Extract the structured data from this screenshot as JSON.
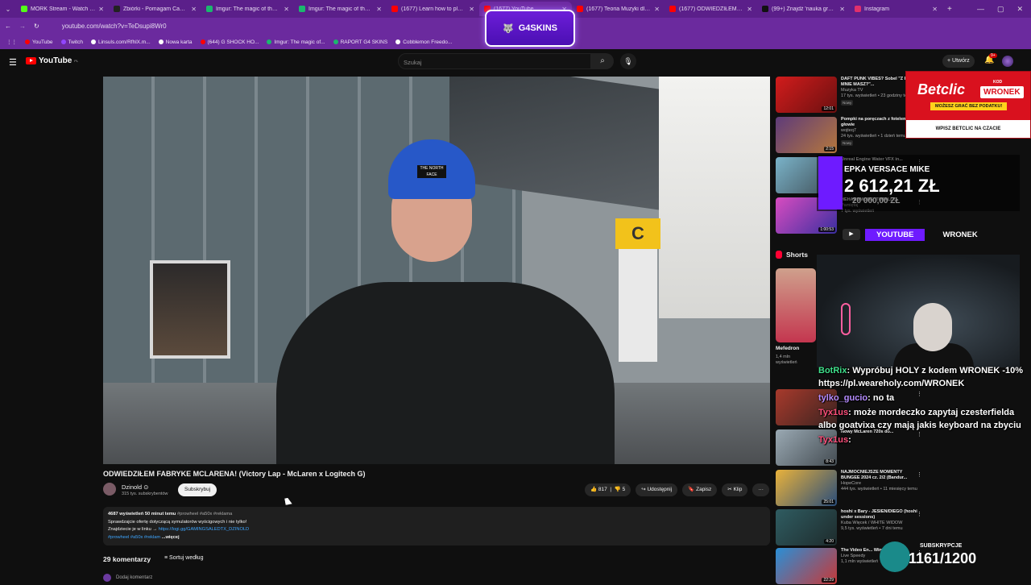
{
  "browser": {
    "tabs": [
      {
        "title": "MORK Stream - Watch Live o",
        "color": "#53fc18"
      },
      {
        "title": "Zbiórki - Pomagam Cancer Fu",
        "color": "#222222"
      },
      {
        "title": "Imgur: The magic of the Inter",
        "color": "#1bb76e"
      },
      {
        "title": "Imgur: The magic of the Inter",
        "color": "#1bb76e"
      },
      {
        "title": "(1677) Learn how to play STIL",
        "color": "#ff0000"
      },
      {
        "title": "(1677) YouTube",
        "color": "#ff0000"
      },
      {
        "title": "(1677) Teoria Muzyki dla Zwyk",
        "color": "#ff0000"
      },
      {
        "title": "(1677) ODWIEDZIŁEM FABRYK",
        "color": "#ff0000"
      },
      {
        "title": "(99+) Znajdź 'nauka gry na pi",
        "color": "#111111"
      },
      {
        "title": "Instagram",
        "color": "#e1306c"
      }
    ],
    "url": "youtube.com/watch?v=TeDsupi8Wr0",
    "bookmarks": [
      {
        "label": "YouTube",
        "color": "#ff0000"
      },
      {
        "label": "Twitch",
        "color": "#9146ff"
      },
      {
        "label": "Linsuls.com/RfhlX.m...",
        "color": "#ffffff"
      },
      {
        "label": "Nowa karta",
        "color": "#ffffff"
      },
      {
        "label": "(644) G SHOCK HO...",
        "color": "#ff0000"
      },
      {
        "label": "Imgur: The magic of...",
        "color": "#1bb76e"
      },
      {
        "label": "RAPORT G4 SKINS",
        "color": "#1bb76e"
      },
      {
        "label": "Cobblemon Freedo...",
        "color": "#ffffff"
      }
    ],
    "overlay_logo": "G4SKINS"
  },
  "youtube": {
    "logo_text": "YouTube",
    "logo_region": "PL",
    "search_placeholder": "Szukaj",
    "create_label": "+ Utwórz",
    "notif_count": "9+"
  },
  "video": {
    "title": "ODWIEDZIŁEM FABRYKE MCLARENA! (Victory Lap - McLaren x Logitech G)",
    "sign_letter": "C",
    "beanie_text": "THE NORTH FACE",
    "channel": "Dzinold ⊙",
    "subscribers": "315 tys. subskrybentów",
    "subscribe_label": "Subskrybuj",
    "likes": "817",
    "dislikes": "5",
    "share_label": "Udostępnij",
    "save_label": "Zapisz",
    "clip_label": "Klip",
    "more_label": "···"
  },
  "description": {
    "stats": "4687 wyświetleń  50 minut temu",
    "stats_tags": "#prowheel #a50x #reklama",
    "line1": "Sprawdzajcie ofertę dotyczącą symulatorów wyścigowych i nie tylko!",
    "line2_prefix": "Znajdziecie je w linku →",
    "link": "https://logi.gg/GAMINGSALEDTX_DZINOLD",
    "tags": "#prowheel  #a50x  #reklam",
    "more": "...więcej"
  },
  "comments": {
    "count_label": "29 komentarzy",
    "sort_label": "Sortuj według",
    "add_label": "Dodaj komentarz"
  },
  "sidebar": {
    "recs": [
      {
        "title": "DAFT PUNK VIBES? Sobel \"Z KOGO MNIE MASZ?\"...",
        "channel": "Muzyka TV",
        "views": "17 tys. wyświetleń • 23 godziny temu",
        "badge": "Nowy",
        "duration": "12:01"
      },
      {
        "title": "Pompki na poręczach z fotelem na głowie",
        "channel": "wojteq7",
        "views": "24 tys. wyświetleń • 1 dzień temu",
        "badge": "Nowy",
        "duration": "2:15"
      },
      {
        "title": "Unreal Engine Water VFX in...",
        "channel": "",
        "views": "",
        "badge": "",
        "duration": ""
      },
      {
        "title": "HEHARDMODE: TOTALLY...",
        "channel": "Pamiętaj",
        "views": "7 tys. wyświetleń",
        "badge": "",
        "duration": "1:00:53"
      },
      {
        "title": "",
        "channel": "",
        "views": "",
        "badge": "",
        "duration": ""
      },
      {
        "title": "Nowy McLaren 720s do...",
        "channel": "",
        "views": "",
        "badge": "",
        "duration": "8:43"
      },
      {
        "title": "NAJMOCNIEJSZE MOMENTY BUNGEE 2024 cz. 2/2 (Bandur...",
        "channel": "HopeCore",
        "views": "444 tys. wyświetleń • 11 miesięcy temu",
        "badge": "",
        "duration": "25:01"
      },
      {
        "title": "hoshi x Bary - JESIEŃ/DIEGO (hoshi under sessions)",
        "channel": "Kuba Więcek / WHITE WIDOW",
        "views": "9,5 tys. wyświetleń • 7 dni temu",
        "badge": "",
        "duration": "4:20"
      },
      {
        "title": "The Video En... Win With My I...",
        "channel": "Live Speedy",
        "views": "1,1 mln wyświetleń",
        "badge": "",
        "duration": "22:29"
      }
    ],
    "shorts_label": "Shorts",
    "short_title": "Mefedron",
    "short_views": "1,4 mln wyświetleń"
  },
  "stream_overlay": {
    "betclic_logo": "Betclic",
    "betclic_kod": "KOD",
    "betclic_code": "WRONEK",
    "betclic_promo": "MOŻESZ GRAĆ BEZ PODATKU!",
    "betclic_footer": "WPISZ  BETCLIC  NA CZACIE",
    "donation_who": "EPKA VERSACE MIKE",
    "donation_amount": "2 612,21 ZŁ",
    "donation_goal": "20 000,00 ZŁ",
    "social_platform": "YOUTUBE",
    "social_name": "WRONEK",
    "chat": [
      {
        "user": "BotRix",
        "text": "Wypróbuj HOLY z kodem WRONEK -10% https://pl.weareholy.com/WRONEK",
        "color": "#3fe08b"
      },
      {
        "user": "tylko_gucio",
        "text": "no ta",
        "color": "#b58cff"
      },
      {
        "user": "Tyx1us",
        "text": "może mordeczko zapytaj czesterfielda albo goatvixa czy mają jakis keyboard na zbyciu",
        "color": "#ff4f7b"
      },
      {
        "user": "Tyx1us",
        "text": "",
        "color": "#ff4f7b"
      }
    ],
    "sub_label": "SUBSKRYPCJE",
    "sub_value": "1161/1200"
  },
  "chart_data": null
}
